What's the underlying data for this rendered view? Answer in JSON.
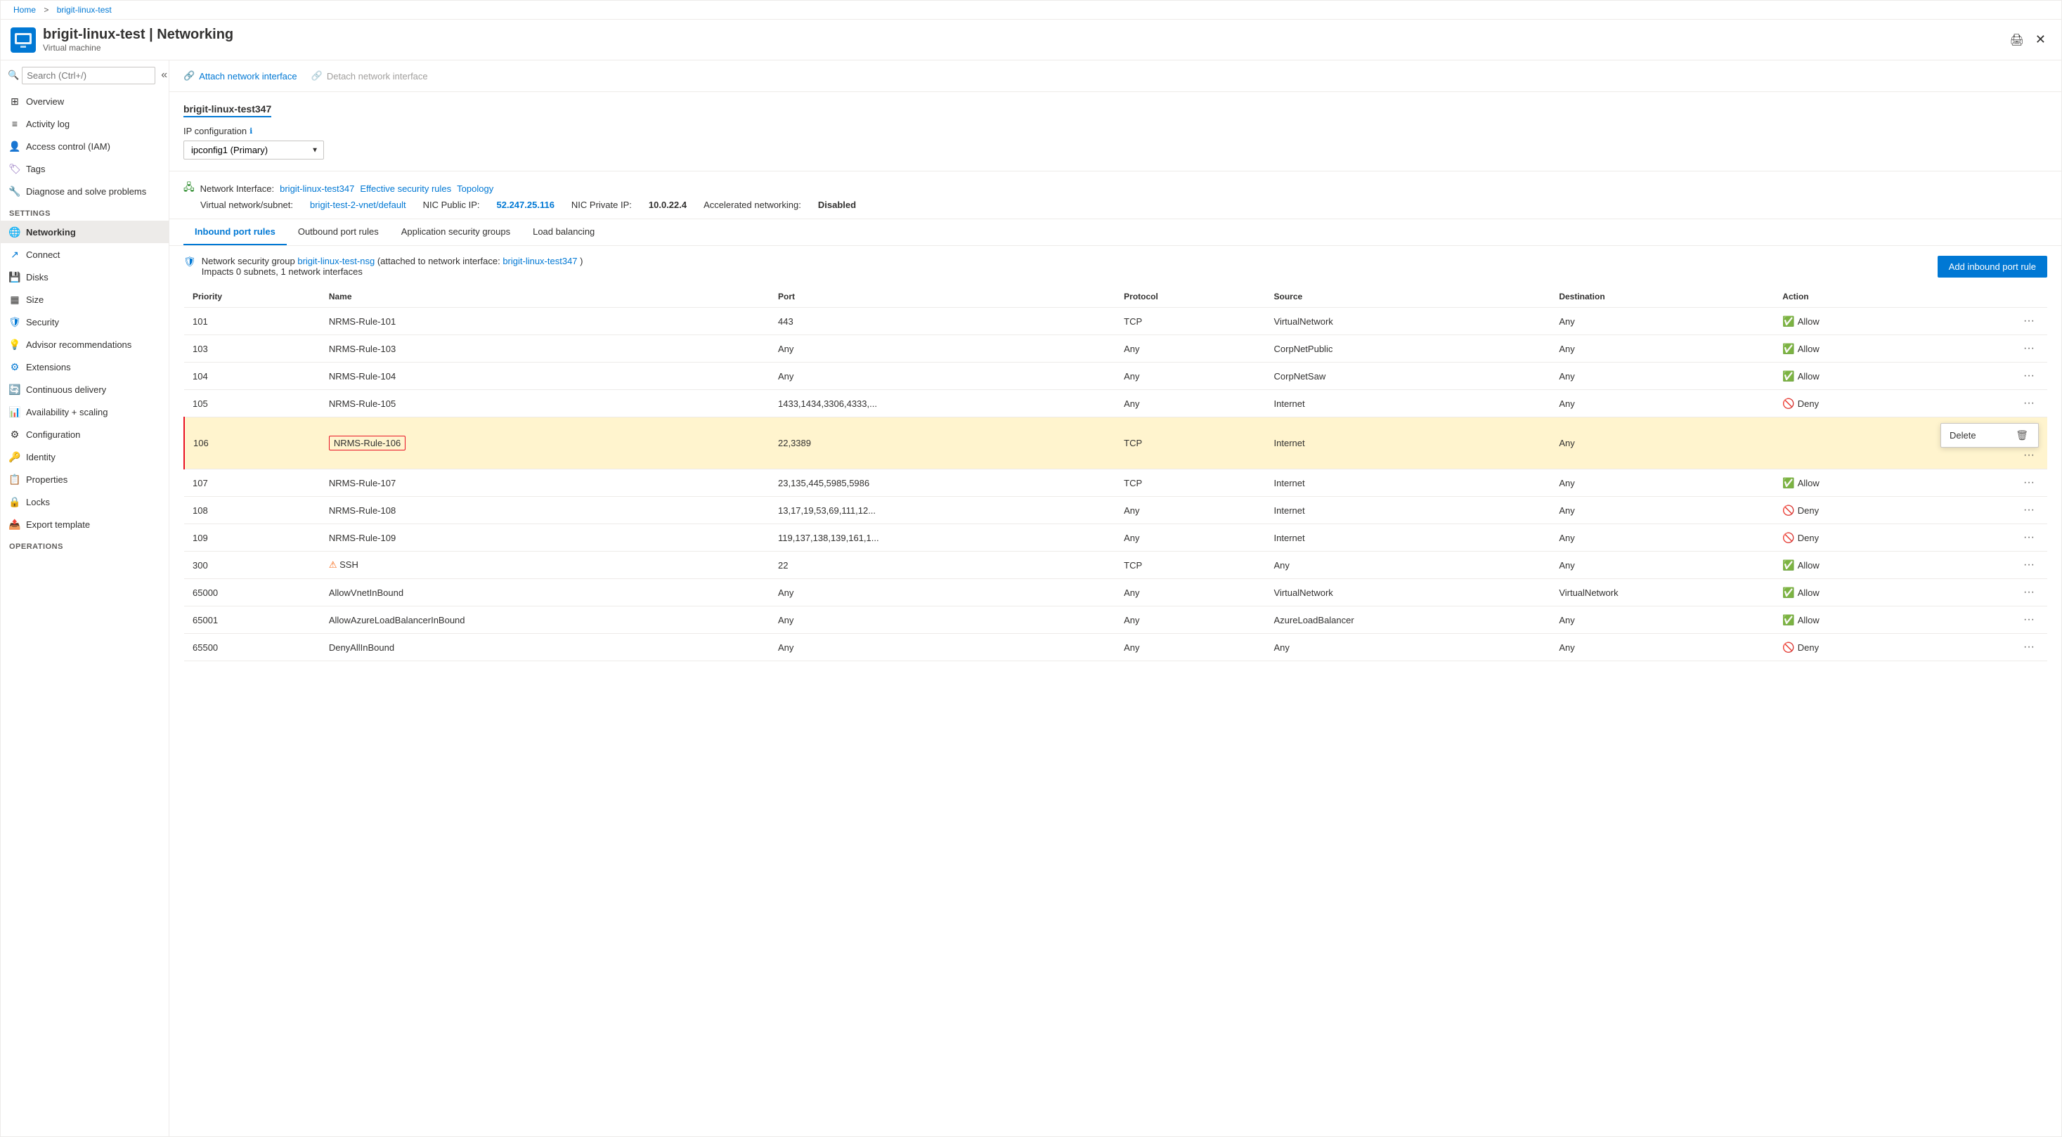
{
  "breadcrumb": {
    "home": "Home",
    "separator": ">",
    "current": "brigit-linux-test"
  },
  "header": {
    "title": "brigit-linux-test | Networking",
    "resource_type": "Virtual machine",
    "print_label": "Print",
    "close_label": "✕"
  },
  "sidebar": {
    "search_placeholder": "Search (Ctrl+/)",
    "collapse_label": "«",
    "items": [
      {
        "id": "overview",
        "label": "Overview",
        "icon": "⊞"
      },
      {
        "id": "activity-log",
        "label": "Activity log",
        "icon": "≡"
      },
      {
        "id": "access-control",
        "label": "Access control (IAM)",
        "icon": "👤"
      },
      {
        "id": "tags",
        "label": "Tags",
        "icon": "🏷"
      },
      {
        "id": "diagnose",
        "label": "Diagnose and solve problems",
        "icon": "🔧"
      }
    ],
    "settings_section": "Settings",
    "settings_items": [
      {
        "id": "networking",
        "label": "Networking",
        "icon": "🌐",
        "active": true
      },
      {
        "id": "connect",
        "label": "Connect",
        "icon": "↗"
      },
      {
        "id": "disks",
        "label": "Disks",
        "icon": "💾"
      },
      {
        "id": "size",
        "label": "Size",
        "icon": "▦"
      },
      {
        "id": "security",
        "label": "Security",
        "icon": "🛡"
      },
      {
        "id": "advisor",
        "label": "Advisor recommendations",
        "icon": "💡"
      },
      {
        "id": "extensions",
        "label": "Extensions",
        "icon": "⚙"
      },
      {
        "id": "continuous-delivery",
        "label": "Continuous delivery",
        "icon": "🔄"
      },
      {
        "id": "availability",
        "label": "Availability + scaling",
        "icon": "📊"
      },
      {
        "id": "configuration",
        "label": "Configuration",
        "icon": "⚙"
      },
      {
        "id": "identity",
        "label": "Identity",
        "icon": "🔑"
      },
      {
        "id": "properties",
        "label": "Properties",
        "icon": "📋"
      },
      {
        "id": "locks",
        "label": "Locks",
        "icon": "🔒"
      },
      {
        "id": "export-template",
        "label": "Export template",
        "icon": "📤"
      }
    ],
    "operations_section": "Operations"
  },
  "toolbar": {
    "attach_label": "Attach network interface",
    "detach_label": "Detach network interface"
  },
  "nic": {
    "name": "brigit-linux-test347",
    "ip_config_label": "IP configuration",
    "ip_config_value": "ipconfig1 (Primary)",
    "network_label": "Network Interface:",
    "network_link": "brigit-linux-test347",
    "effective_security": "Effective security rules",
    "topology": "Topology",
    "vnet_label": "Virtual network/subnet:",
    "vnet_link": "brigit-test-2-vnet/default",
    "nic_public_ip_label": "NIC Public IP:",
    "nic_public_ip_value": "52.247.25.116",
    "nic_private_ip_label": "NIC Private IP:",
    "nic_private_ip_value": "10.0.22.4",
    "accelerated_label": "Accelerated networking:",
    "accelerated_value": "Disabled"
  },
  "tabs": [
    {
      "id": "inbound",
      "label": "Inbound port rules",
      "active": true
    },
    {
      "id": "outbound",
      "label": "Outbound port rules",
      "active": false
    },
    {
      "id": "app-security",
      "label": "Application security groups",
      "active": false
    },
    {
      "id": "load-balancing",
      "label": "Load balancing",
      "active": false
    }
  ],
  "rules": {
    "nsg_prefix": "Network security group",
    "nsg_link": "brigit-linux-test-nsg",
    "nsg_attached": "(attached to network interface:",
    "nsg_attached_link": "brigit-linux-test347",
    "nsg_impacts": "Impacts 0 subnets, 1 network interfaces",
    "add_rule_label": "Add inbound port rule",
    "columns": [
      "Priority",
      "Name",
      "Port",
      "Protocol",
      "Source",
      "Destination",
      "Action"
    ],
    "rows": [
      {
        "priority": "101",
        "name": "NRMS-Rule-101",
        "port": "443",
        "protocol": "TCP",
        "source": "VirtualNetwork",
        "destination": "Any",
        "action": "Allow",
        "highlighted": false
      },
      {
        "priority": "103",
        "name": "NRMS-Rule-103",
        "port": "Any",
        "protocol": "Any",
        "source": "CorpNetPublic",
        "destination": "Any",
        "action": "Allow",
        "highlighted": false
      },
      {
        "priority": "104",
        "name": "NRMS-Rule-104",
        "port": "Any",
        "protocol": "Any",
        "source": "CorpNetSaw",
        "destination": "Any",
        "action": "Allow",
        "highlighted": false
      },
      {
        "priority": "105",
        "name": "NRMS-Rule-105",
        "port": "1433,1434,3306,4333,...",
        "protocol": "Any",
        "source": "Internet",
        "destination": "Any",
        "action": "Deny",
        "highlighted": false
      },
      {
        "priority": "106",
        "name": "NRMS-Rule-106",
        "port": "22,3389",
        "protocol": "TCP",
        "source": "Internet",
        "destination": "Any",
        "action": "",
        "highlighted": true,
        "show_delete": true
      },
      {
        "priority": "107",
        "name": "NRMS-Rule-107",
        "port": "23,135,445,5985,5986",
        "protocol": "TCP",
        "source": "Internet",
        "destination": "Any",
        "action": "Allow",
        "highlighted": false
      },
      {
        "priority": "108",
        "name": "NRMS-Rule-108",
        "port": "13,17,19,53,69,111,12...",
        "protocol": "Any",
        "source": "Internet",
        "destination": "Any",
        "action": "Deny",
        "highlighted": false
      },
      {
        "priority": "109",
        "name": "NRMS-Rule-109",
        "port": "119,137,138,139,161,1...",
        "protocol": "Any",
        "source": "Internet",
        "destination": "Any",
        "action": "Deny",
        "highlighted": false
      },
      {
        "priority": "300",
        "name": "SSH",
        "port": "22",
        "protocol": "TCP",
        "source": "Any",
        "destination": "Any",
        "action": "Allow",
        "highlighted": false,
        "warn": true
      },
      {
        "priority": "65000",
        "name": "AllowVnetInBound",
        "port": "Any",
        "protocol": "Any",
        "source": "VirtualNetwork",
        "destination": "VirtualNetwork",
        "action": "Allow",
        "highlighted": false
      },
      {
        "priority": "65001",
        "name": "AllowAzureLoadBalancerInBound",
        "port": "Any",
        "protocol": "Any",
        "source": "AzureLoadBalancer",
        "destination": "Any",
        "action": "Allow",
        "highlighted": false
      },
      {
        "priority": "65500",
        "name": "DenyAllInBound",
        "port": "Any",
        "protocol": "Any",
        "source": "Any",
        "destination": "Any",
        "action": "Deny",
        "highlighted": false
      }
    ],
    "delete_label": "Delete"
  }
}
